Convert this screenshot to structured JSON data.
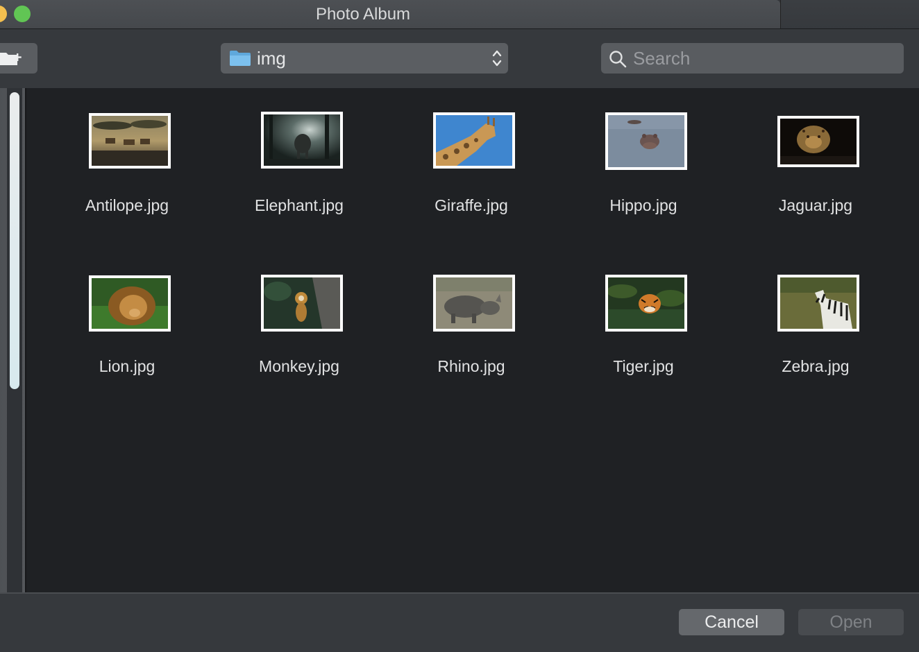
{
  "window": {
    "title": "Photo Album"
  },
  "toolbar": {
    "new_folder_icon": "new-folder-icon",
    "path": {
      "label": "img",
      "icon": "folder-icon",
      "control_icon": "updown-arrows-icon"
    },
    "search": {
      "placeholder": "Search",
      "value": "",
      "icon": "magnifier-icon"
    }
  },
  "files": [
    {
      "name": "Antilope.jpg",
      "thumbnail": "antelope-photo"
    },
    {
      "name": "Elephant.jpg",
      "thumbnail": "elephant-photo"
    },
    {
      "name": "Giraffe.jpg",
      "thumbnail": "giraffe-photo"
    },
    {
      "name": "Hippo.jpg",
      "thumbnail": "hippo-photo"
    },
    {
      "name": "Jaguar.jpg",
      "thumbnail": "jaguar-photo"
    },
    {
      "name": "Lion.jpg",
      "thumbnail": "lion-photo"
    },
    {
      "name": "Monkey.jpg",
      "thumbnail": "monkey-photo"
    },
    {
      "name": "Rhino.jpg",
      "thumbnail": "rhino-photo"
    },
    {
      "name": "Tiger.jpg",
      "thumbnail": "tiger-photo"
    },
    {
      "name": "Zebra.jpg",
      "thumbnail": "zebra-photo"
    }
  ],
  "buttons": {
    "cancel": "Cancel",
    "open": "Open"
  },
  "colors": {
    "titlebar": "#4a4d51",
    "toolbar": "#36393d",
    "content_bg": "#1f2124",
    "traffic_yellow": "#f4bf4f",
    "traffic_green": "#61c554"
  }
}
